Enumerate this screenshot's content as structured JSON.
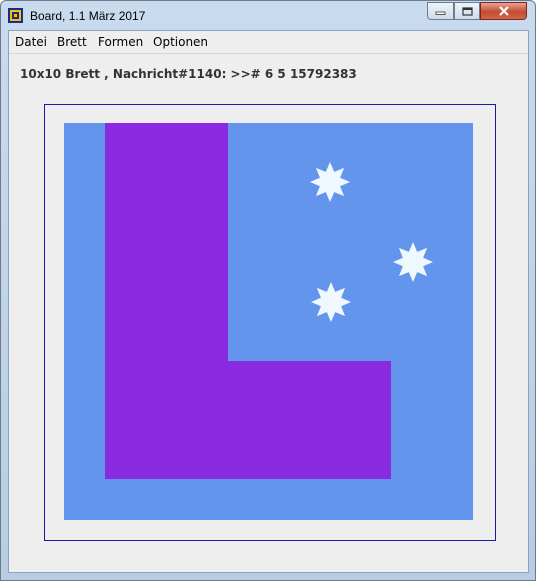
{
  "window": {
    "title": "Board, 1.1 März 2017"
  },
  "menu": [
    {
      "label": "Datei"
    },
    {
      "label": "Brett"
    },
    {
      "label": "Formen"
    },
    {
      "label": "Optionen"
    }
  ],
  "status_text": "10x10 Brett , Nachricht#1140: >># 6 5 15792383",
  "colors": {
    "board_background": "#6495ed",
    "shape_fill": "#8a2be2",
    "star_fill": "#f0f8ff",
    "frame_border": "#1a1aa0"
  },
  "board": {
    "grid_size": "10x10",
    "shape": "L-shape",
    "stars": 3
  }
}
